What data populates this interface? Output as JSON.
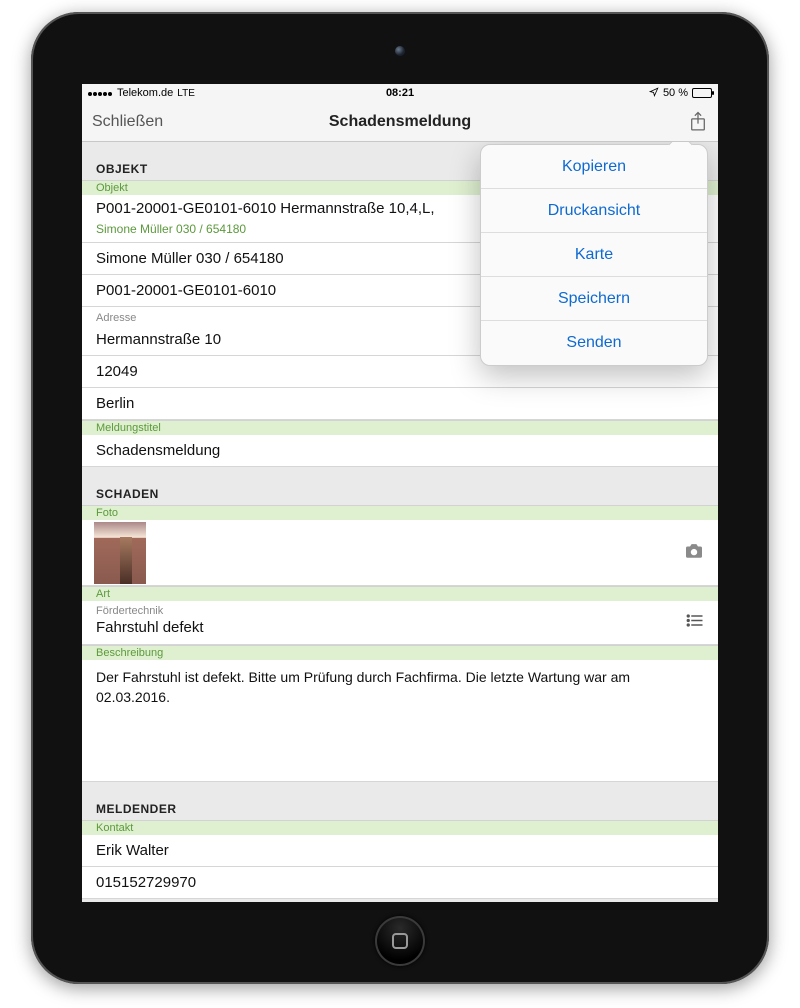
{
  "statusbar": {
    "carrier": "Telekom.de",
    "network": "LTE",
    "time": "08:21",
    "battery_text": "50 %"
  },
  "navbar": {
    "back_label": "Schließen",
    "title": "Schadensmeldung"
  },
  "popover": {
    "items": [
      "Kopieren",
      "Druckansicht",
      "Karte",
      "Speichern",
      "Senden"
    ]
  },
  "sections": {
    "objekt": {
      "header": "OBJEKT",
      "labels": {
        "objekt": "Objekt",
        "adresse": "Adresse",
        "meldungstitel": "Meldungstitel"
      },
      "objekt_line": "P001-20001-GE0101-6010 Hermannstraße 10,4,L,",
      "objekt_sub": "Simone Müller 030  /  654180",
      "contact_line": "Simone Müller 030  /  654180",
      "id_line": "P001-20001-GE0101-6010",
      "street": "Hermannstraße 10",
      "zip": "12049",
      "city": "Berlin",
      "meldungstitel_value": "Schadensmeldung"
    },
    "schaden": {
      "header": "SCHADEN",
      "labels": {
        "foto": "Foto",
        "art": "Art",
        "beschreibung": "Beschreibung"
      },
      "art_category": "Fördertechnik",
      "art_value": "Fahrstuhl defekt",
      "beschreibung_text": "Der Fahrstuhl ist defekt. Bitte um Prüfung durch Fachfirma. Die letzte Wartung war am 02.03.2016."
    },
    "meldender": {
      "header": "MELDENDER",
      "labels": {
        "kontakt": "Kontakt"
      },
      "name": "Erik Walter",
      "phone": "015152729970"
    }
  }
}
